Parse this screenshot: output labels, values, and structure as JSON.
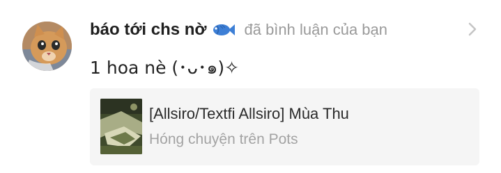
{
  "notification": {
    "username": "báo tới chs nờ",
    "badge_icon": "fish-icon",
    "action_text": "đã bình luận của bạn",
    "comment": "1 hoa nè (･ᴗ･๑)✧",
    "avatar_icon": "cat-avatar",
    "chevron_icon": "chevron-right-icon"
  },
  "story_card": {
    "title": "[Allsiro/Textfi Allsiro] Mùa Thu",
    "subtitle": "Hóng chuyện trên Pots",
    "thumbnail_icon": "story-cover-image"
  },
  "colors": {
    "username": "#1f1f1f",
    "muted": "#9a9a9a",
    "card_bg": "#f5f5f5",
    "fish_blue": "#3d7fd6"
  }
}
